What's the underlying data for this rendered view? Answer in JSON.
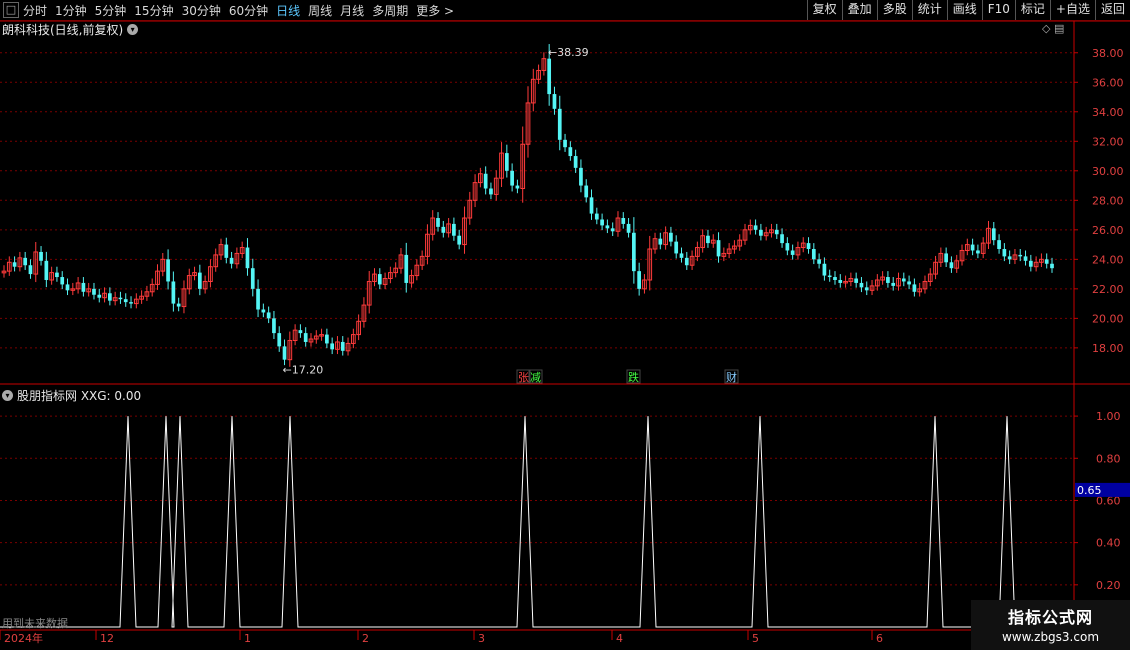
{
  "toolbar": {
    "box_label": "□",
    "periods": [
      "分时",
      "1分钟",
      "5分钟",
      "15分钟",
      "30分钟",
      "60分钟",
      "日线",
      "周线",
      "月线",
      "多周期",
      "更多 >"
    ],
    "active_period": "日线",
    "right_buttons": [
      "复权",
      "叠加",
      "多股",
      "统计",
      "画线",
      "F10",
      "标记",
      "+自选",
      "返回"
    ]
  },
  "colors": {
    "up": "#ff3b3b",
    "down": "#54f5f5",
    "grid": "#7a0000",
    "axis": "#c80000",
    "ind_line": "#ffffff",
    "highlight": "#0000a0"
  },
  "main_chart": {
    "title": "朗科科技(日线,前复权)",
    "top_right_icons": "◇ ▤",
    "high_label": "38.39",
    "low_label": "17.20",
    "event_labels": [
      {
        "text": "张",
        "color": "#ff4444"
      },
      {
        "text": "减",
        "color": "#44ff44"
      },
      {
        "text": "跌",
        "color": "#44ff44"
      },
      {
        "text": "财",
        "color": "#88ccff"
      }
    ]
  },
  "indicator": {
    "title": "股朋指标网  XXG: 0.00",
    "highlight_value": "0.65",
    "future_note": "用到未来数据"
  },
  "x_axis": {
    "labels": [
      "2024年",
      "12",
      "1",
      "2",
      "3",
      "4",
      "5",
      "6"
    ]
  },
  "watermark": {
    "line1": "指标公式网",
    "line2": "www.zbgs3.com"
  },
  "chart_data": [
    {
      "type": "candlestick",
      "title": "朗科科技(日线,前复权)",
      "ylim": [
        16.5,
        39
      ],
      "yticks": [
        "18.00",
        "20.00",
        "22.00",
        "24.00",
        "26.00",
        "28.00",
        "30.00",
        "32.00",
        "34.00",
        "36.00",
        "38.00"
      ],
      "grid": true,
      "closes": [
        23.2,
        23.8,
        23.5,
        24.1,
        23.6,
        23.0,
        24.5,
        23.9,
        22.6,
        23.1,
        22.8,
        22.3,
        21.9,
        22.0,
        22.4,
        21.8,
        22.0,
        21.6,
        21.4,
        21.7,
        21.2,
        21.4,
        21.3,
        21.1,
        21.0,
        21.3,
        21.5,
        21.8,
        22.3,
        23.2,
        24.0,
        22.5,
        21.0,
        20.8,
        22.0,
        22.9,
        23.1,
        22.0,
        22.5,
        23.5,
        24.3,
        25.0,
        24.1,
        23.7,
        24.4,
        24.8,
        23.4,
        22.0,
        20.6,
        20.4,
        20.0,
        19.0,
        18.1,
        17.2,
        18.5,
        19.2,
        19.0,
        18.4,
        18.6,
        18.8,
        18.9,
        18.3,
        17.9,
        18.4,
        17.8,
        18.3,
        18.9,
        19.8,
        20.9,
        22.5,
        23.0,
        22.3,
        22.7,
        23.1,
        23.4,
        24.3,
        22.4,
        22.9,
        23.6,
        24.2,
        25.7,
        26.8,
        26.2,
        25.8,
        26.4,
        25.6,
        25.0,
        26.8,
        28.0,
        29.2,
        29.8,
        28.8,
        28.4,
        29.5,
        31.2,
        30.0,
        29.0,
        28.8,
        31.8,
        34.6,
        36.2,
        36.8,
        37.6,
        35.2,
        34.2,
        32.1,
        31.6,
        31.0,
        30.2,
        29.0,
        28.2,
        27.1,
        26.7,
        26.3,
        26.1,
        25.9,
        26.8,
        26.4,
        25.8,
        23.2,
        22.0,
        22.6,
        24.7,
        25.4,
        25.0,
        25.8,
        25.2,
        24.4,
        24.1,
        23.6,
        24.2,
        24.8,
        25.6,
        25.1,
        25.3,
        24.2,
        24.4,
        24.7,
        24.9,
        25.3,
        26.0,
        26.3,
        26.0,
        25.6,
        25.8,
        26.0,
        25.7,
        25.1,
        24.6,
        24.3,
        24.8,
        25.1,
        24.7,
        24.0,
        23.7,
        22.9,
        22.8,
        22.6,
        22.4,
        22.5,
        22.7,
        22.4,
        22.1,
        21.9,
        22.2,
        22.6,
        22.8,
        22.4,
        22.2,
        22.7,
        22.5,
        22.3,
        21.8,
        22.0,
        22.5,
        23.0,
        23.8,
        24.4,
        23.8,
        23.4,
        23.9,
        24.6,
        25.0,
        24.6,
        24.4,
        25.1,
        26.1,
        25.3,
        24.7,
        24.2,
        24.0,
        24.3,
        24.2,
        23.9,
        23.5,
        23.8,
        24.0,
        23.7,
        23.4
      ]
    },
    {
      "type": "line",
      "name": "XXG",
      "ylim": [
        0,
        1.1
      ],
      "yticks": [
        "0.20",
        "0.40",
        "0.60",
        "0.80",
        "1.00"
      ],
      "x_range": [
        0,
        1000
      ],
      "spikes_at_x": [
        128,
        166,
        180,
        232,
        290,
        525,
        648,
        760,
        935,
        1007
      ],
      "spike_value": 1.0,
      "baseline": 0.0
    }
  ]
}
